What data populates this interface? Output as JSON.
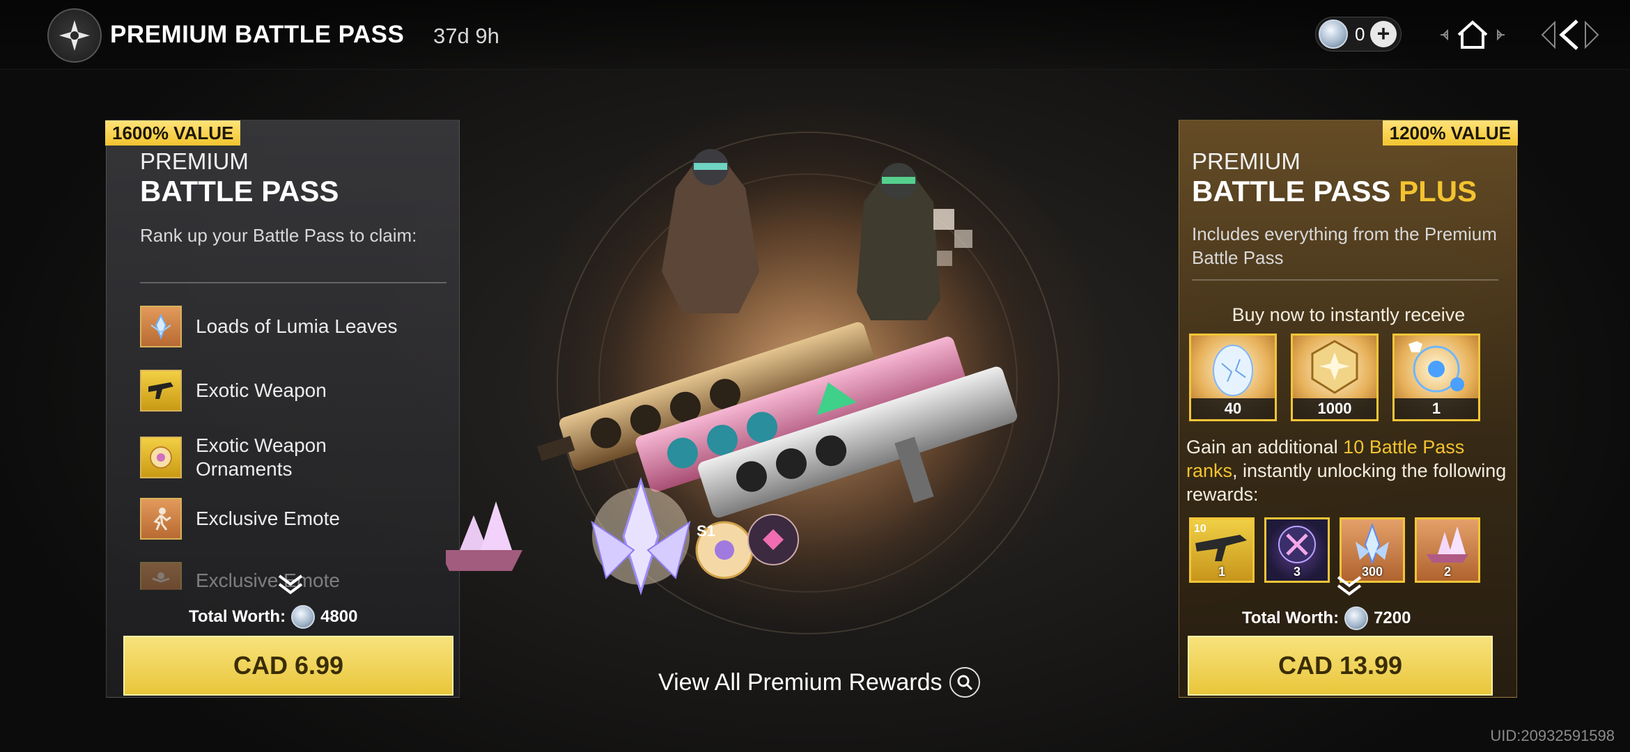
{
  "header": {
    "title": "PREMIUM BATTLE PASS",
    "timer": "37d 9h",
    "currency_amount": "0",
    "icons": [
      "battle-pass-emblem-icon",
      "lumia-coin-icon",
      "plus-icon",
      "home-icon",
      "back-icon"
    ]
  },
  "left_panel": {
    "value_tag": "1600% VALUE",
    "kicker": "PREMIUM",
    "heading": "BATTLE PASS",
    "description": "Rank up your Battle Pass to claim:",
    "perks": [
      {
        "label": "Loads of Lumia Leaves",
        "icon": "lumia-leaves-icon"
      },
      {
        "label": "Exotic Weapon",
        "icon": "exotic-weapon-icon"
      },
      {
        "label": "Exotic Weapon Ornaments",
        "icon": "weapon-ornament-icon"
      },
      {
        "label": "Exclusive Emote",
        "icon": "emote-icon"
      },
      {
        "label": "Exclusive Emote",
        "icon": "emote-icon"
      }
    ],
    "worth_label": "Total Worth:",
    "worth_value": "4800",
    "price": "CAD 6.99"
  },
  "right_panel": {
    "value_tag": "1200% VALUE",
    "kicker": "PREMIUM",
    "heading_main": "BATTLE PASS ",
    "heading_accent": "PLUS",
    "description": "Includes everything from the Premium Battle Pass",
    "instant_title": "Buy now to instantly receive",
    "instant_rewards": [
      {
        "qty": "40",
        "icon": "egg-icon"
      },
      {
        "qty": "1000",
        "icon": "rank-emblem-icon"
      },
      {
        "qty": "1",
        "icon": "outfit-bundle-icon"
      }
    ],
    "ranks_text_pre": "Gain an additional ",
    "ranks_text_accent": "10 Battle Pass ranks",
    "ranks_text_post": ", instantly unlocking the following rewards:",
    "unlock_rewards": [
      {
        "qty": "1",
        "badge": "10",
        "icon": "rifle-icon",
        "color": "#e9c232"
      },
      {
        "qty": "3",
        "icon": "portal-orb-icon",
        "color": "#e9c232"
      },
      {
        "qty": "300",
        "icon": "crystal-leaves-icon",
        "color": "#d98a4f"
      },
      {
        "qty": "2",
        "icon": "ship-icon",
        "color": "#d98a4f"
      }
    ],
    "worth_label": "Total Worth:",
    "worth_value": "7200",
    "price": "CAD 13.99"
  },
  "center": {
    "view_all_label": "View All Premium Rewards",
    "season_badge": "S1"
  },
  "footer": {
    "uid": "UID:20932591598"
  },
  "colors": {
    "accent_gold": "#f3c330",
    "button_gold": "#f7e27c",
    "tag_gold": "#f2c42f"
  }
}
